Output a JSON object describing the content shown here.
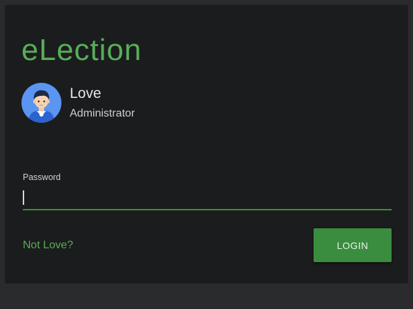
{
  "app": {
    "title": "eLection"
  },
  "user": {
    "name": "Love",
    "role": "Administrator",
    "avatar_icon": "user-avatar-icon"
  },
  "password": {
    "label": "Password",
    "value": "",
    "placeholder": ""
  },
  "actions": {
    "switch_user_label": "Not Love?",
    "login_label": "LOGIN"
  },
  "colors": {
    "background": "#2a2b2d",
    "card": "#1b1c1d",
    "accent": "#58ad58",
    "button": "#3a8c3e",
    "text": "#e6e6e6"
  }
}
